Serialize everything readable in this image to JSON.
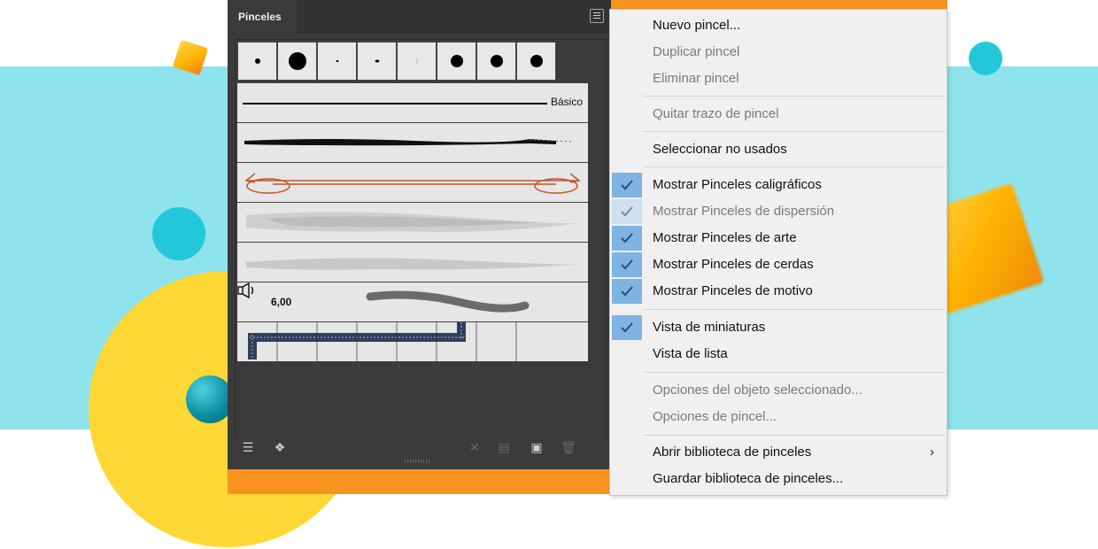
{
  "panel": {
    "tab_label": "Pinceles",
    "basic_brush_label": "Básico",
    "bristle_size": "6,00",
    "footer_icons": [
      "brush-library-icon",
      "brush-libraries-menu-icon",
      "remove-brush-stroke-icon",
      "options-icon",
      "new-brush-icon",
      "delete-brush-icon"
    ]
  },
  "menu": {
    "items": [
      {
        "label": "Nuevo pincel...",
        "enabled": true,
        "checked": false
      },
      {
        "label": "Duplicar pincel",
        "enabled": false,
        "checked": false
      },
      {
        "label": "Eliminar pincel",
        "enabled": false,
        "checked": false
      },
      {
        "label": "Quitar trazo de pincel",
        "enabled": false,
        "checked": false
      },
      {
        "label": "Seleccionar no usados",
        "enabled": true,
        "checked": false
      },
      {
        "label": "Mostrar Pinceles caligráficos",
        "enabled": true,
        "checked": true
      },
      {
        "label": "Mostrar Pinceles de dispersión",
        "enabled": false,
        "checked": true
      },
      {
        "label": "Mostrar Pinceles de arte",
        "enabled": true,
        "checked": true
      },
      {
        "label": "Mostrar Pinceles de cerdas",
        "enabled": true,
        "checked": true
      },
      {
        "label": "Mostrar Pinceles de motivo",
        "enabled": true,
        "checked": true
      },
      {
        "label": "Vista de miniaturas",
        "enabled": true,
        "checked": true
      },
      {
        "label": "Vista de lista",
        "enabled": true,
        "checked": false
      },
      {
        "label": "Opciones del objeto seleccionado...",
        "enabled": false,
        "checked": false
      },
      {
        "label": "Opciones de pincel...",
        "enabled": false,
        "checked": false
      },
      {
        "label": "Abrir biblioteca de pinceles",
        "enabled": true,
        "checked": false,
        "submenu": true
      },
      {
        "label": "Guardar biblioteca de pinceles...",
        "enabled": true,
        "checked": false
      }
    ]
  },
  "colors": {
    "accent_orange": "#f7931e",
    "check_highlight": "#7fb4e2",
    "background_band": "#8fe3ec",
    "yellow_circle": "#fdd835"
  }
}
